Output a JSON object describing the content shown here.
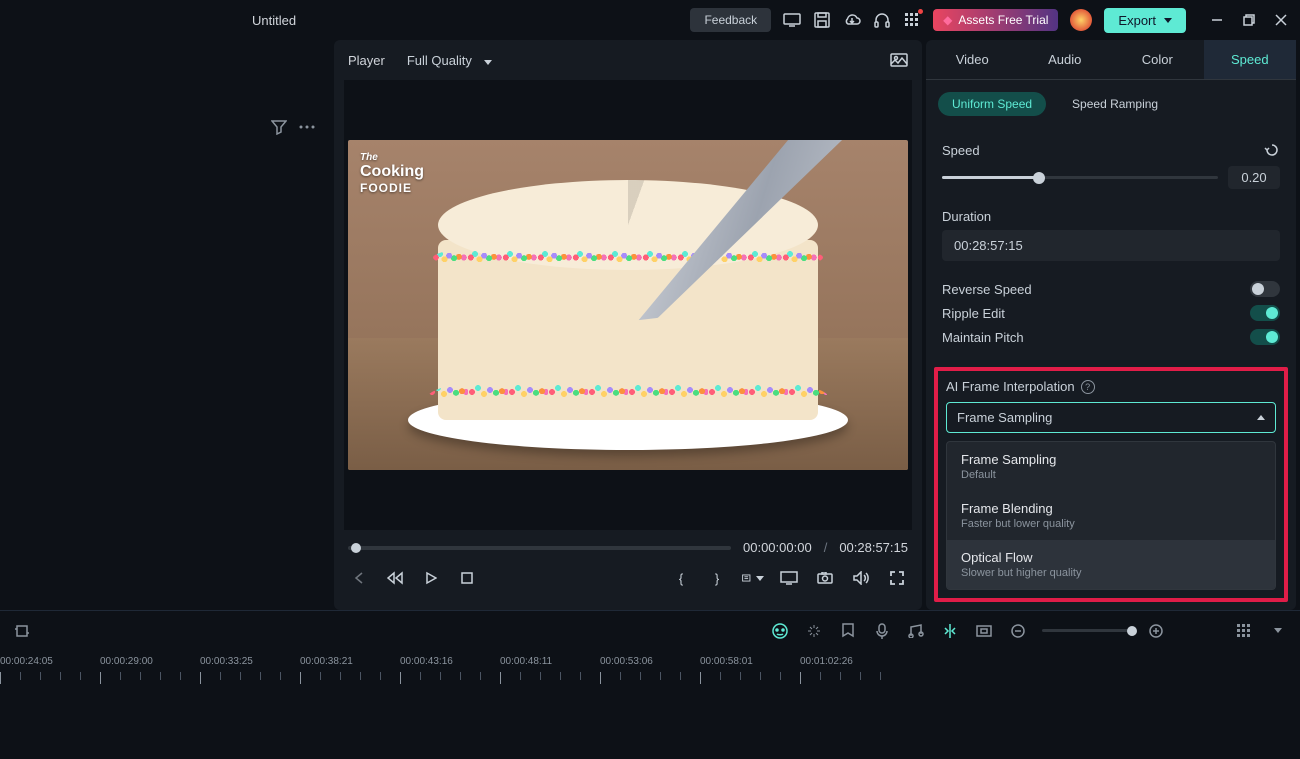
{
  "titlebar": {
    "title": "Untitled",
    "feedback": "Feedback",
    "assets_trial": "Assets Free Trial",
    "export": "Export"
  },
  "player": {
    "label": "Player",
    "quality": "Full Quality",
    "logo": {
      "l1": "The",
      "l2": "Cooking",
      "l3": "FOODIE"
    },
    "current_time": "00:00:00:00",
    "total_time": "00:28:57:15",
    "separator": "/"
  },
  "inspector": {
    "tabs": [
      "Video",
      "Audio",
      "Color",
      "Speed"
    ],
    "active_tab": "Speed",
    "subtabs": [
      "Uniform Speed",
      "Speed Ramping"
    ],
    "active_subtab": "Uniform Speed",
    "speed": {
      "label": "Speed",
      "value": "0.20",
      "slider_pct": 35
    },
    "duration": {
      "label": "Duration",
      "value": "00:28:57:15"
    },
    "reverse": {
      "label": "Reverse Speed",
      "on": false
    },
    "ripple": {
      "label": "Ripple Edit",
      "on": true
    },
    "pitch": {
      "label": "Maintain Pitch",
      "on": true
    },
    "ai": {
      "label": "AI Frame Interpolation",
      "selected": "Frame Sampling",
      "options": [
        {
          "name": "Frame Sampling",
          "desc": "Default"
        },
        {
          "name": "Frame Blending",
          "desc": "Faster but lower quality"
        },
        {
          "name": "Optical Flow",
          "desc": "Slower but higher quality"
        }
      ]
    }
  },
  "timeline": {
    "timestamps": [
      "00:00:24:05",
      "00:00:29:00",
      "00:00:33:25",
      "00:00:38:21",
      "00:00:43:16",
      "00:00:48:11",
      "00:00:53:06",
      "00:00:58:01",
      "00:01:02:26"
    ]
  }
}
